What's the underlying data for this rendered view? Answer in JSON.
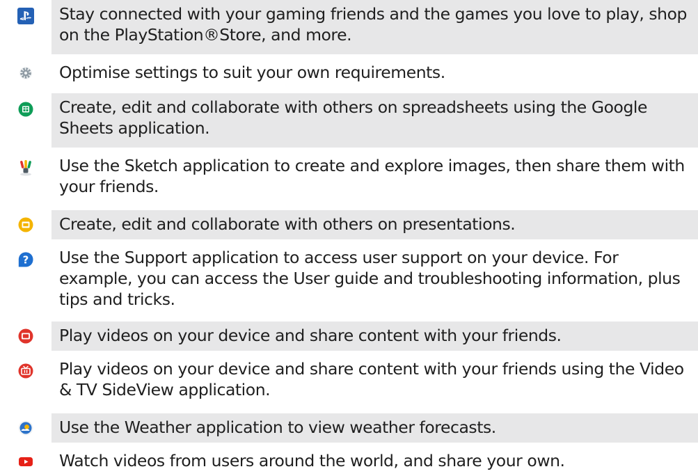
{
  "apps": [
    {
      "icon": "playstation-icon",
      "description": "Stay connected with your gaming friends and the games you love to play, shop on the PlayStation®Store, and more."
    },
    {
      "icon": "settings-gear-icon",
      "description": "Optimise settings to suit your own requirements."
    },
    {
      "icon": "google-sheets-icon",
      "description": "Create, edit and collaborate with others on spreadsheets using the Google Sheets application."
    },
    {
      "icon": "sketch-brush-icon",
      "description": "Use the Sketch application to create and explore images, then share them with your friends."
    },
    {
      "icon": "google-slides-icon",
      "description": "Create, edit and collaborate with others on presentations."
    },
    {
      "icon": "support-question-icon",
      "description": "Use the Support application to access user support on your device. For example, you can access the User guide and troubleshooting information, plus tips and tricks."
    },
    {
      "icon": "video-icon",
      "description": "Play videos on your device and share content with your friends."
    },
    {
      "icon": "video-tv-sideview-icon",
      "description": "Play videos on your device and share content with your friends using the Video & TV SideView application."
    },
    {
      "icon": "weather-icon",
      "description": "Use the Weather application to view weather forecasts."
    },
    {
      "icon": "youtube-icon",
      "description": "Watch videos from users around the world, and share your own."
    }
  ],
  "colors": {
    "row_shade": "#e7e7e8",
    "text": "#1f1f1f",
    "playstation": "#2461b5",
    "gear": "#8e9aa3",
    "sheets": "#0f9d58",
    "slides": "#f4b400",
    "support": "#1e6fd0",
    "video": "#e0342b",
    "weather": "#2d73c9",
    "youtube": "#e62117"
  }
}
